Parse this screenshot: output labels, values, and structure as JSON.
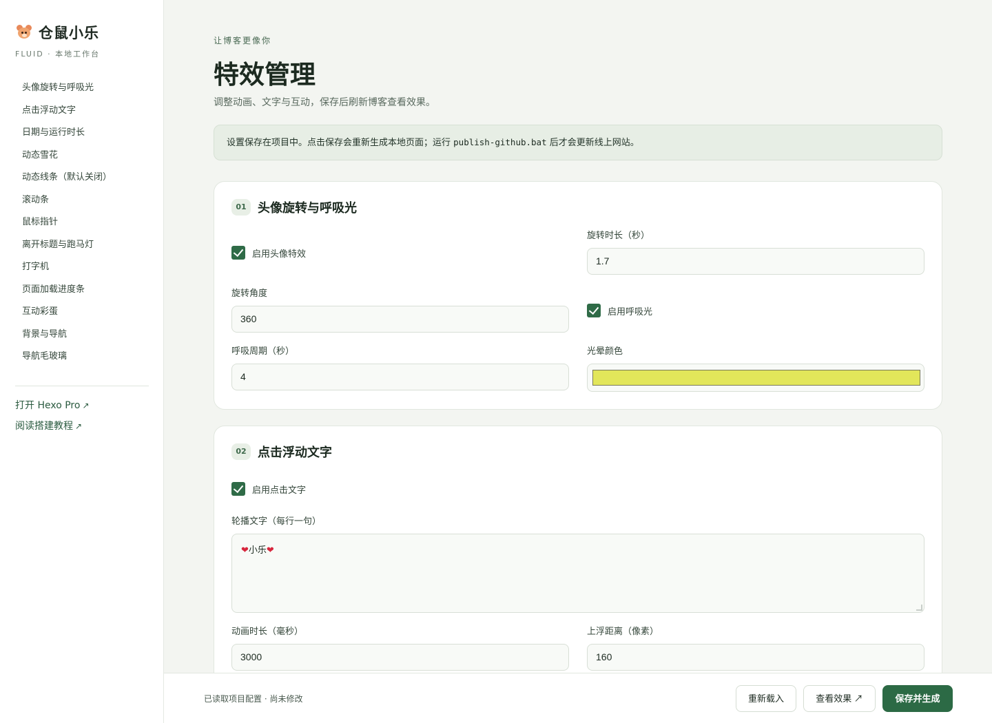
{
  "brand": {
    "name": "仓鼠小乐",
    "subtitle": "FLUID · 本地工作台"
  },
  "sidebar": {
    "items": [
      {
        "label": "头像旋转与呼吸光"
      },
      {
        "label": "点击浮动文字"
      },
      {
        "label": "日期与运行时长"
      },
      {
        "label": "动态雪花"
      },
      {
        "label": "动态线条（默认关闭）"
      },
      {
        "label": "滚动条"
      },
      {
        "label": "鼠标指针"
      },
      {
        "label": "离开标题与跑马灯"
      },
      {
        "label": "打字机"
      },
      {
        "label": "页面加载进度条"
      },
      {
        "label": "互动彩蛋"
      },
      {
        "label": "背景与导航"
      },
      {
        "label": "导航毛玻璃"
      }
    ],
    "links": [
      {
        "label": "打开 Hexo Pro",
        "arrow": "↗"
      },
      {
        "label": "阅读搭建教程",
        "arrow": "↗"
      }
    ]
  },
  "header": {
    "eyebrow": "让博客更像你",
    "title": "特效管理",
    "description": "调整动画、文字与互动，保存后刷新博客查看效果。"
  },
  "notice": {
    "before": "设置保存在项目中。点击保存会重新生成本地页面；运行 ",
    "code": "publish-github.bat",
    "after": " 后才会更新线上网站。"
  },
  "sections": [
    {
      "number": "01",
      "title": "头像旋转与呼吸光",
      "enable_avatar_label": "启用头像特效",
      "rotate_duration_label": "旋转时长（秒）",
      "rotate_duration_value": "1.7",
      "rotate_angle_label": "旋转角度",
      "rotate_angle_value": "360",
      "enable_breath_label": "启用呼吸光",
      "breath_period_label": "呼吸周期（秒）",
      "breath_period_value": "4",
      "glow_color_label": "光晕颜色",
      "glow_color_value": "#e2e65a"
    },
    {
      "number": "02",
      "title": "点击浮动文字",
      "enable_click_label": "启用点击文字",
      "carousel_label": "轮播文字（每行一句）",
      "carousel_heart": "❤",
      "carousel_text": "小乐",
      "anim_duration_label": "动画时长（毫秒）",
      "anim_duration_value": "3000",
      "float_distance_label": "上浮距离（像素）",
      "float_distance_value": "160"
    }
  ],
  "footer": {
    "status": "已读取项目配置 · 尚未修改",
    "reload_label": "重新载入",
    "preview_label": "查看效果 ↗",
    "save_label": "保存并生成"
  },
  "colors": {
    "accent": "#2c6a45",
    "background": "#f3f5f1",
    "notice_bg": "#e7eee5",
    "glow": "#e2e65a"
  }
}
